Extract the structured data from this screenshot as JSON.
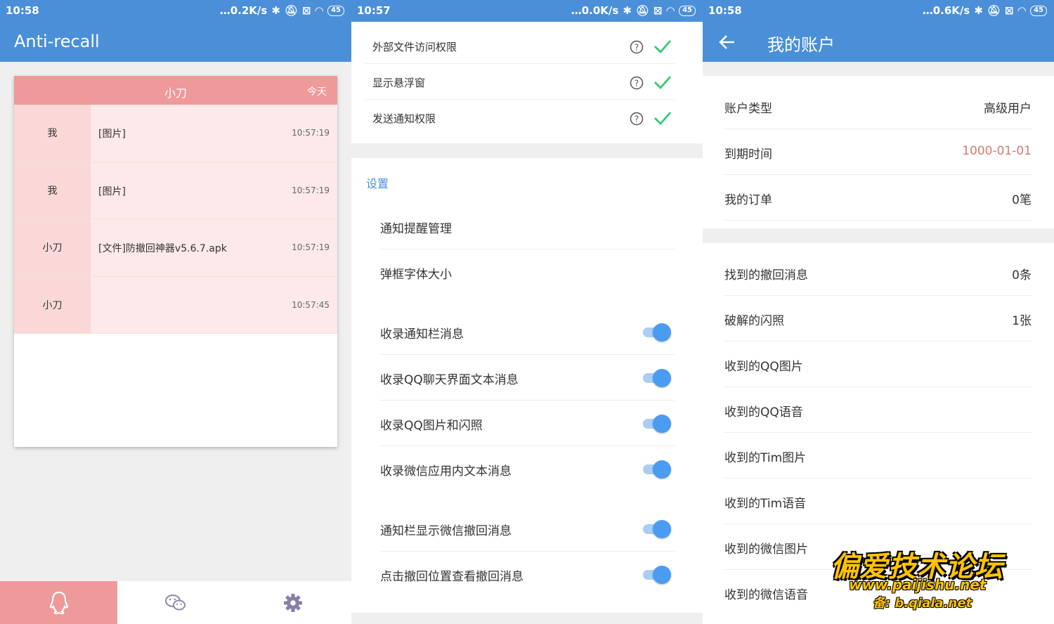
{
  "colors": {
    "primary": "#4a8fd8",
    "accent_pink": "#ee9a9a",
    "check_green": "#2ecc71",
    "switch_blue": "#4a9cf0",
    "expiry_red": "#d57a70"
  },
  "panel1": {
    "status": {
      "time": "10:58",
      "speed": "0.2K/s",
      "battery": "45"
    },
    "title": "Anti-recall",
    "card": {
      "contact": "小刀",
      "date": "今天",
      "messages": [
        {
          "sender": "我",
          "text": "[图片]",
          "time": "10:57:19"
        },
        {
          "sender": "我",
          "text": "[图片]",
          "time": "10:57:19"
        },
        {
          "sender": "小刀",
          "text": "[文件]防撤回神器v5.6.7.apk",
          "time": "10:57:19"
        },
        {
          "sender": "小刀",
          "text": "",
          "time": "10:57:45"
        }
      ]
    },
    "nav": [
      {
        "icon": "qq-icon",
        "selected": true
      },
      {
        "icon": "wechat-icon",
        "selected": false
      },
      {
        "icon": "gear-icon",
        "selected": false
      }
    ]
  },
  "panel2": {
    "status": {
      "time": "10:57",
      "speed": "0.0K/s",
      "battery": "45"
    },
    "permissions": [
      {
        "label": "外部文件访问权限",
        "granted": true
      },
      {
        "label": "显示悬浮窗",
        "granted": true
      },
      {
        "label": "发送通知权限",
        "granted": true
      }
    ],
    "section_title": "设置",
    "settings": [
      {
        "label": "通知提醒管理"
      },
      {
        "label": "弹框字体大小"
      },
      {
        "label": "收录通知栏消息",
        "on": true
      },
      {
        "label": "收录QQ聊天界面文本消息",
        "on": true
      },
      {
        "label": "收录QQ图片和闪照",
        "on": true
      },
      {
        "label": "收录微信应用内文本消息",
        "on": true
      },
      {
        "label": "通知栏显示微信撤回消息",
        "on": true
      },
      {
        "label": "点击撤回位置查看撤回消息",
        "on": true
      }
    ]
  },
  "panel3": {
    "status": {
      "time": "10:58",
      "speed": "0.6K/s",
      "battery": "45"
    },
    "title": "我的账户",
    "account": [
      {
        "label": "账户类型",
        "value": "高级用户"
      },
      {
        "label": "到期时间",
        "value": "1000-01-01"
      },
      {
        "label": "我的订单",
        "value": "0笔"
      }
    ],
    "stats": [
      {
        "label": "找到的撤回消息",
        "value": "0条"
      },
      {
        "label": "破解的闪照",
        "value": "1张"
      },
      {
        "label": "收到的QQ图片",
        "value": ""
      },
      {
        "label": "收到的QQ语音",
        "value": ""
      },
      {
        "label": "收到的Tim图片",
        "value": ""
      },
      {
        "label": "收到的Tim语音",
        "value": ""
      },
      {
        "label": "收到的微信图片",
        "value": ""
      },
      {
        "label": "收到的微信语音",
        "value": ""
      }
    ]
  },
  "watermark": {
    "title": "偏爱技术论坛",
    "url": "www.paijishu.net",
    "backup": "备: b.qiala.net"
  }
}
